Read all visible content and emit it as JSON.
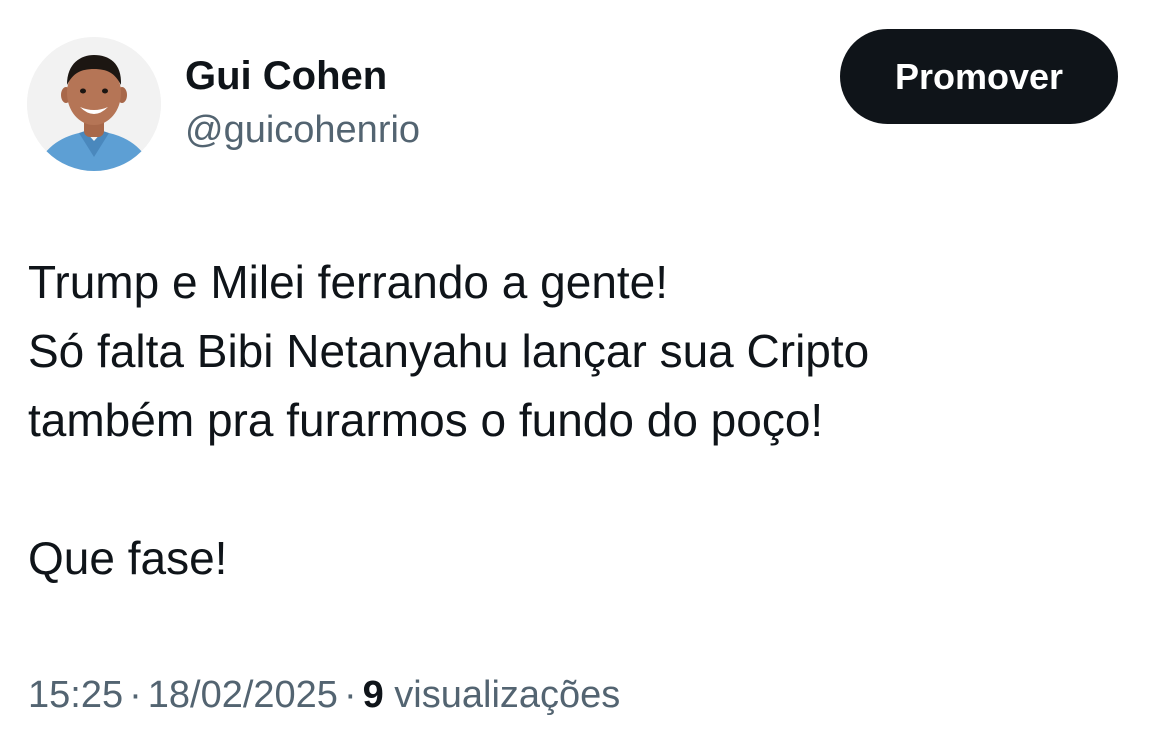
{
  "author": {
    "display_name": "Gui Cohen",
    "handle": "@guicohenrio"
  },
  "actions": {
    "promote_label": "Promover"
  },
  "tweet": {
    "lines": [
      "Trump e Milei ferrando a gente!",
      "Só falta Bibi Netanyahu lançar sua Cripto",
      "também pra furarmos o fundo do poço!",
      "Que fase!"
    ]
  },
  "meta": {
    "time": "15:25",
    "separator": "·",
    "date": "18/02/2025",
    "views_count": "9",
    "views_label": "visualizações"
  },
  "colors": {
    "text_primary": "#0f1419",
    "text_secondary": "#536471",
    "button_bg": "#0f1419",
    "button_text": "#ffffff"
  }
}
